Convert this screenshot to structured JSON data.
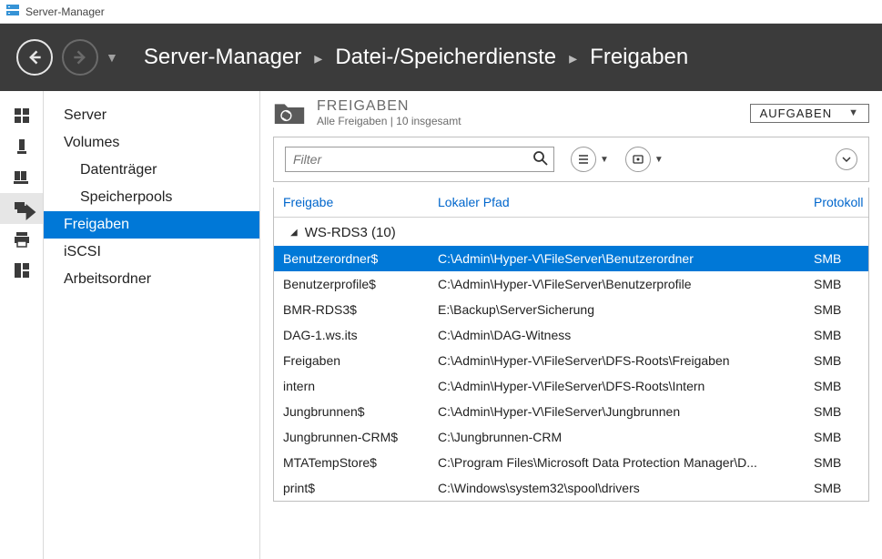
{
  "app": {
    "title": "Server-Manager"
  },
  "breadcrumb": {
    "a": "Server-Manager",
    "b": "Datei-/Speicherdienste",
    "c": "Freigaben"
  },
  "sidebar": {
    "server": "Server",
    "volumes": "Volumes",
    "disks": "Datenträger",
    "pools": "Speicherpools",
    "shares": "Freigaben",
    "iscsi": "iSCSI",
    "workfolders": "Arbeitsordner"
  },
  "section": {
    "heading": "FREIGABEN",
    "sub": "Alle Freigaben | 10 insgesamt",
    "tasks": "AUFGABEN"
  },
  "toolbar": {
    "filter_placeholder": "Filter"
  },
  "table": {
    "col_share": "Freigabe",
    "col_path": "Lokaler Pfad",
    "col_proto": "Protokoll",
    "group": "WS-RDS3 (10)",
    "rows": [
      {
        "share": "Benutzerordner$",
        "path": "C:\\Admin\\Hyper-V\\FileServer\\Benutzerordner",
        "proto": "SMB",
        "selected": true
      },
      {
        "share": "Benutzerprofile$",
        "path": "C:\\Admin\\Hyper-V\\FileServer\\Benutzerprofile",
        "proto": "SMB"
      },
      {
        "share": "BMR-RDS3$",
        "path": "E:\\Backup\\ServerSicherung",
        "proto": "SMB"
      },
      {
        "share": "DAG-1.ws.its",
        "path": "C:\\Admin\\DAG-Witness",
        "proto": "SMB"
      },
      {
        "share": "Freigaben",
        "path": "C:\\Admin\\Hyper-V\\FileServer\\DFS-Roots\\Freigaben",
        "proto": "SMB"
      },
      {
        "share": "intern",
        "path": "C:\\Admin\\Hyper-V\\FileServer\\DFS-Roots\\Intern",
        "proto": "SMB"
      },
      {
        "share": "Jungbrunnen$",
        "path": "C:\\Admin\\Hyper-V\\FileServer\\Jungbrunnen",
        "proto": "SMB"
      },
      {
        "share": "Jungbrunnen-CRM$",
        "path": "C:\\Jungbrunnen-CRM",
        "proto": "SMB"
      },
      {
        "share": "MTATempStore$",
        "path": "C:\\Program Files\\Microsoft Data Protection Manager\\D...",
        "proto": "SMB"
      },
      {
        "share": "print$",
        "path": "C:\\Windows\\system32\\spool\\drivers",
        "proto": "SMB"
      }
    ]
  }
}
